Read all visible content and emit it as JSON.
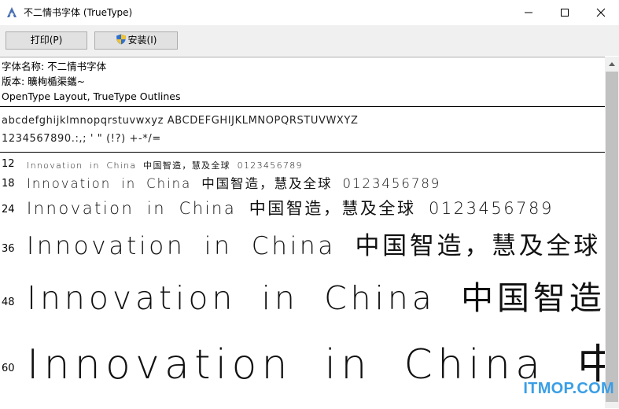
{
  "window": {
    "title": "不二情书字体 (TrueType)"
  },
  "toolbar": {
    "print_label": "打印(P)",
    "install_label": "安装(I)"
  },
  "info": {
    "font_name": "字体名称: 不二情书字体",
    "version": "版本: 曠栒楯渠鑴~",
    "type": "OpenType Layout, TrueType Outlines"
  },
  "charset": {
    "letters": "abcdefghijklmnopqrstuvwxyz  ABCDEFGHIJKLMNOPQRSTUVWXYZ",
    "digits": "1234567890.:,;  '  \"  (!?)  +-*/="
  },
  "samples": [
    {
      "size": "12",
      "text": "Innovation in China 中国智造，慧及全球 0123456789"
    },
    {
      "size": "18",
      "text": "Innovation in China 中国智造，慧及全球 0123456789"
    },
    {
      "size": "24",
      "text": "Innovation in China 中国智造，慧及全球 0123456789"
    },
    {
      "size": "36",
      "text": "Innovation in China 中国智造，慧及全球"
    },
    {
      "size": "48",
      "text": "Innovation in China 中国智造"
    },
    {
      "size": "60",
      "text": "Innovation in China 中国"
    }
  ],
  "watermark": "ITMOP.COM",
  "colors": {
    "toolbar_bg": "#f0f0f0",
    "button_bg": "#e1e1e1",
    "watermark": "#3a9ee6"
  }
}
